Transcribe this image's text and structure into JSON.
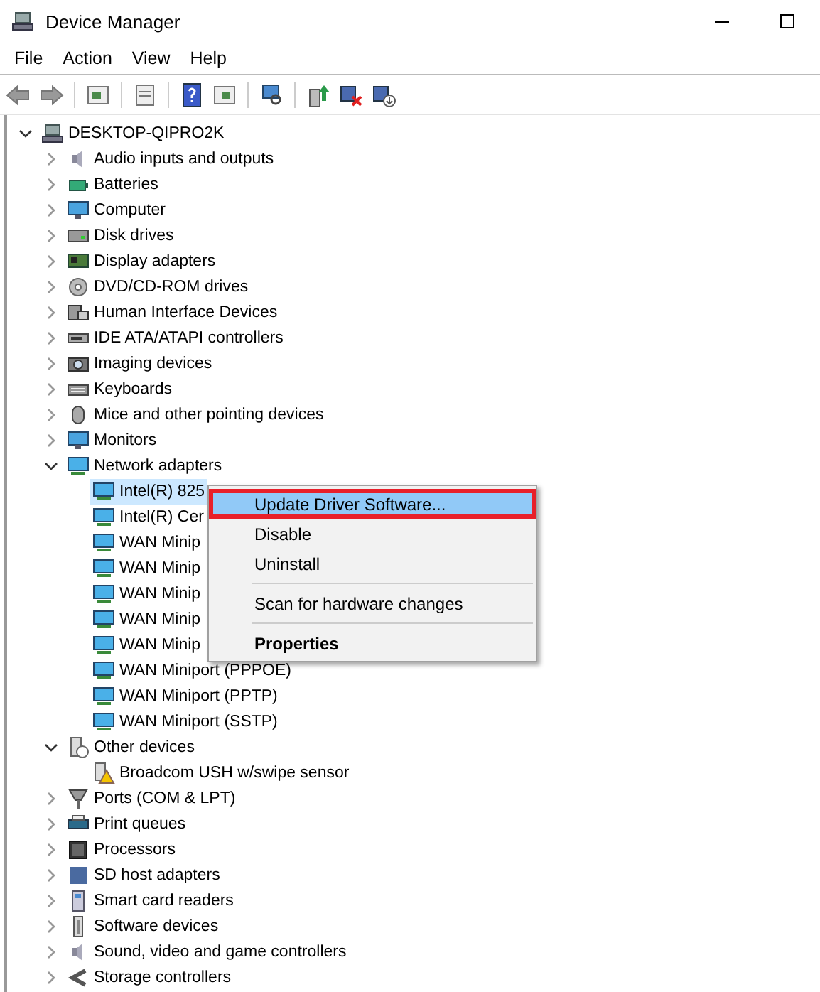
{
  "window": {
    "title": "Device Manager"
  },
  "menu_bar": [
    "File",
    "Action",
    "View",
    "Help"
  ],
  "tree": {
    "label": "DESKTOP-QIPRO2K",
    "expanded": true,
    "children": [
      {
        "label": "Audio inputs and outputs",
        "expanded": false
      },
      {
        "label": "Batteries",
        "expanded": false
      },
      {
        "label": "Computer",
        "expanded": false
      },
      {
        "label": "Disk drives",
        "expanded": false
      },
      {
        "label": "Display adapters",
        "expanded": false
      },
      {
        "label": "DVD/CD-ROM drives",
        "expanded": false
      },
      {
        "label": "Human Interface Devices",
        "expanded": false
      },
      {
        "label": "IDE ATA/ATAPI controllers",
        "expanded": false
      },
      {
        "label": "Imaging devices",
        "expanded": false
      },
      {
        "label": "Keyboards",
        "expanded": false
      },
      {
        "label": "Mice and other pointing devices",
        "expanded": false
      },
      {
        "label": "Monitors",
        "expanded": false
      },
      {
        "label": "Network adapters",
        "expanded": true,
        "children": [
          {
            "label": "Intel(R) 825",
            "selected": true
          },
          {
            "label": "Intel(R) Cer",
            "selected": false
          },
          {
            "label": "WAN Minip",
            "selected": false
          },
          {
            "label": "WAN Minip",
            "selected": false
          },
          {
            "label": "WAN Minip",
            "selected": false
          },
          {
            "label": "WAN Minip",
            "selected": false
          },
          {
            "label": "WAN Minip",
            "selected": false
          },
          {
            "label": "WAN Miniport (PPPOE)",
            "selected": false
          },
          {
            "label": "WAN Miniport (PPTP)",
            "selected": false
          },
          {
            "label": "WAN Miniport (SSTP)",
            "selected": false
          }
        ]
      },
      {
        "label": "Other devices",
        "expanded": true,
        "children": [
          {
            "label": "Broadcom USH w/swipe sensor",
            "selected": false
          }
        ]
      },
      {
        "label": "Ports (COM & LPT)",
        "expanded": false
      },
      {
        "label": "Print queues",
        "expanded": false
      },
      {
        "label": "Processors",
        "expanded": false
      },
      {
        "label": "SD host adapters",
        "expanded": false
      },
      {
        "label": "Smart card readers",
        "expanded": false
      },
      {
        "label": "Software devices",
        "expanded": false
      },
      {
        "label": "Sound, video and game controllers",
        "expanded": false
      },
      {
        "label": "Storage controllers",
        "expanded": false
      }
    ]
  },
  "context_menu": [
    {
      "kind": "item",
      "label": "Update Driver Software...",
      "selected": true,
      "default": false
    },
    {
      "kind": "item",
      "label": "Disable",
      "selected": false,
      "default": false
    },
    {
      "kind": "item",
      "label": "Uninstall",
      "selected": false,
      "default": false
    },
    {
      "kind": "separator"
    },
    {
      "kind": "item",
      "label": "Scan for hardware changes",
      "selected": false,
      "default": false
    },
    {
      "kind": "separator"
    },
    {
      "kind": "item",
      "label": "Properties",
      "selected": false,
      "default": true
    }
  ]
}
